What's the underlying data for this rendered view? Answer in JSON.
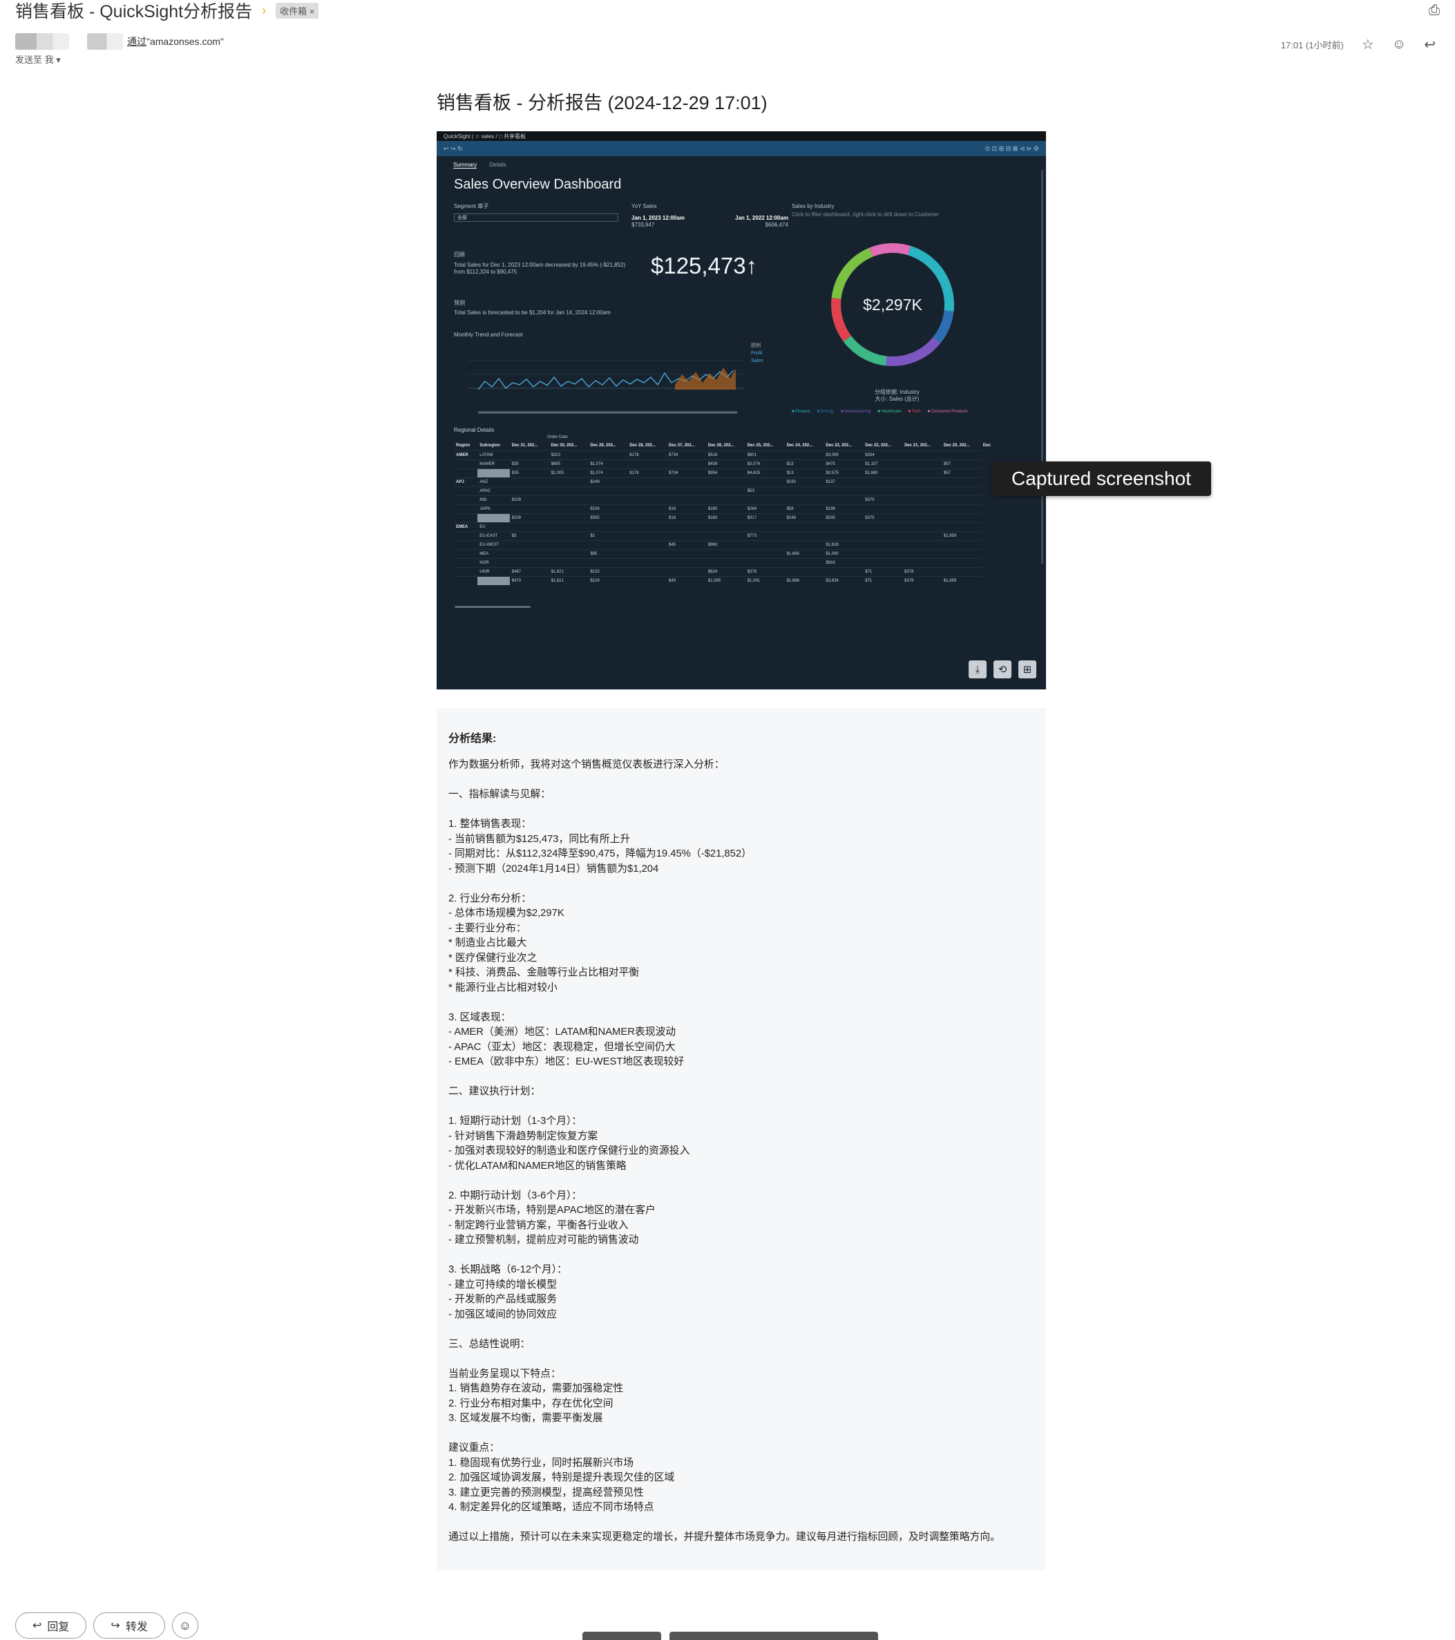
{
  "mail": {
    "subject": "销售看板 - QuickSight分析报告",
    "label": "收件箱 ×",
    "via_text": "通过",
    "via_domain": "\"amazonses.com\"",
    "to_me": "发送至 我 ▾",
    "time": "17:01 (1小时前)",
    "icons": [
      "important-icon",
      "print-icon",
      "star-icon",
      "emoji-icon",
      "reply-icon"
    ]
  },
  "report": {
    "title": "销售看板 - 分析报告 (2024-12-29 17:01)"
  },
  "dashboard": {
    "top_bar": "QuickSight | ☆ sales / □ 共享看板",
    "tabs": [
      "Summary",
      "Details"
    ],
    "title": "Sales Overview Dashboard",
    "segment_label": "Segment 章子",
    "segment_value": "全部",
    "yoy_label": "YoY Sales",
    "yoy_left_date": "Jan 1, 2023 12:00am",
    "yoy_left_value": "$733,947",
    "yoy_right_date": "Jan 1, 2022 12:00am",
    "yoy_right_value": "$606,474",
    "kpi_section": "回顾",
    "kpi_text": "Total Sales for Dec 1, 2023 12:00am decreased by 19.45% (-$21,852) from $112,324 to $90,475",
    "kpi_value": "$125,473↑",
    "forecast_section": "预测",
    "forecast_text": "Total Sales is forecasted to be $1,204 for Jan 14, 2024 12:00am",
    "industry_title": "Sales by Industry",
    "industry_hint": "Click to filter dashboard, right-click to drill down to Customer",
    "donut_total": "$2,297K",
    "donut_caption_1": "分组依据: Industry",
    "donut_caption_2": "大小: Sales (总计)",
    "donut_colors": [
      "#2ab3c0",
      "#2d6fb3",
      "#7d57c1",
      "#3fb889",
      "#e0434f",
      "#7bc142",
      "#df6db5"
    ],
    "donut_shares": [
      0.22,
      0.09,
      0.16,
      0.13,
      0.12,
      0.17,
      0.11
    ],
    "legend": [
      "Finance",
      "Energy",
      "Manufacturing",
      "Healthcare",
      "Tech",
      "Consumer Products"
    ],
    "trend_title": "Monthly Trend and Forecast",
    "trend_legend": [
      "图例",
      "Profit",
      "Sales"
    ],
    "regional_title": "Regional Details",
    "order_date": "Order Date",
    "table_headers": [
      "Region",
      "Subregion",
      "Dec 31, 202...",
      "Dec 30, 202...",
      "Dec 29, 202...",
      "Dec 28, 202...",
      "Dec 27, 202...",
      "Dec 26, 202...",
      "Dec 25, 202...",
      "Dec 24, 202...",
      "Dec 23, 202...",
      "Dec 22, 202...",
      "Dec 21, 202...",
      "Dec 20, 202...",
      "Dec"
    ],
    "table_rows": [
      [
        "AMER",
        "LATAM",
        "",
        "$310",
        "",
        "$178",
        "$734",
        "$516",
        "$601",
        "",
        "$3,099",
        "$334",
        "",
        ""
      ],
      [
        "",
        "NAMER",
        "$35",
        "$695",
        "$1,074",
        "",
        "",
        "$438",
        "$3,074",
        "$13",
        "$475",
        "$1,157",
        "",
        "$57"
      ],
      [
        "",
        "总计",
        "$35",
        "$1,005",
        "$1,074",
        "$178",
        "$734",
        "$954",
        "$4,625",
        "$13",
        "$3,575",
        "$1,680",
        "",
        "$57"
      ],
      [
        "APJ",
        "ANZ",
        "",
        "",
        "$249",
        "",
        "",
        "",
        "",
        "$190",
        "$137",
        "",
        "",
        ""
      ],
      [
        "",
        "APAC",
        "",
        "",
        "",
        "",
        "",
        "",
        "$53",
        "",
        "",
        "",
        "",
        ""
      ],
      [
        "",
        "IND",
        "$209",
        "",
        "",
        "",
        "",
        "",
        "",
        "",
        "",
        "$375",
        "",
        ""
      ],
      [
        "",
        "JAPN",
        "",
        "",
        "$106",
        "",
        "$16",
        "$160",
        "$264",
        "$58",
        "$198",
        "",
        "",
        ""
      ],
      [
        "",
        "总计",
        "$209",
        "",
        "$355",
        "",
        "$16",
        "$160",
        "$317",
        "$248",
        "$335",
        "$375",
        "",
        ""
      ],
      [
        "EMEA",
        "EU",
        "",
        "",
        "",
        "",
        "",
        "",
        "",
        "",
        "",
        "",
        "",
        ""
      ],
      [
        "",
        "EU-EAST",
        "$3",
        "",
        "$1",
        "",
        "",
        "",
        "$773",
        "",
        "",
        "",
        "",
        "$1,859"
      ],
      [
        "",
        "EU-WEST",
        "",
        "",
        "",
        "",
        "$45",
        "$960",
        "",
        "",
        "$1,628",
        "",
        "",
        ""
      ],
      [
        "",
        "MEA",
        "",
        "",
        "$95",
        "",
        "",
        "",
        "",
        "$1,666",
        "$1,090",
        "",
        "",
        ""
      ],
      [
        "",
        "NOR",
        "",
        "",
        "",
        "",
        "",
        "",
        "",
        "",
        "$916",
        "",
        "",
        ""
      ],
      [
        "",
        "UKIR",
        "$467",
        "$1,821",
        "$133",
        "",
        "",
        "$624",
        "$378",
        "",
        "",
        "$71",
        "$378",
        ""
      ],
      [
        "",
        "总计",
        "$470",
        "$1,821",
        "$229",
        "",
        "$45",
        "$1,595",
        "$1,091",
        "$1,666",
        "$3,634",
        "$71",
        "$378",
        "$1,859"
      ]
    ],
    "bottom_icons": [
      "download-icon",
      "share-icon",
      "add-icon"
    ]
  },
  "tooltip": "Captured screenshot",
  "analysis": {
    "lines": [
      {
        "t": "分析结果:",
        "bold": true
      },
      {
        "t": "作为数据分析师，我将对这个销售概览仪表板进行深入分析："
      },
      {
        "t": ""
      },
      {
        "t": "一、指标解读与见解："
      },
      {
        "t": ""
      },
      {
        "t": "1. 整体销售表现："
      },
      {
        "t": "- 当前销售额为$125,473，同比有所上升"
      },
      {
        "t": "- 同期对比：从$112,324降至$90,475，降幅为19.45%（-$21,852）"
      },
      {
        "t": "- 预测下期（2024年1月14日）销售额为$1,204"
      },
      {
        "t": ""
      },
      {
        "t": "2. 行业分布分析："
      },
      {
        "t": "- 总体市场规模为$2,297K"
      },
      {
        "t": "- 主要行业分布："
      },
      {
        "t": "* 制造业占比最大"
      },
      {
        "t": "* 医疗保健行业次之"
      },
      {
        "t": "* 科技、消费品、金融等行业占比相对平衡"
      },
      {
        "t": "* 能源行业占比相对较小"
      },
      {
        "t": ""
      },
      {
        "t": "3. 区域表现："
      },
      {
        "t": "- AMER（美洲）地区：LATAM和NAMER表现波动"
      },
      {
        "t": "- APAC（亚太）地区：表现稳定，但增长空间仍大"
      },
      {
        "t": "- EMEA（欧非中东）地区：EU-WEST地区表现较好"
      },
      {
        "t": ""
      },
      {
        "t": "二、建议执行计划："
      },
      {
        "t": ""
      },
      {
        "t": "1. 短期行动计划（1-3个月）："
      },
      {
        "t": "- 针对销售下滑趋势制定恢复方案"
      },
      {
        "t": "- 加强对表现较好的制造业和医疗保健行业的资源投入"
      },
      {
        "t": "- 优化LATAM和NAMER地区的销售策略"
      },
      {
        "t": ""
      },
      {
        "t": "2. 中期行动计划（3-6个月）："
      },
      {
        "t": "- 开发新兴市场，特别是APAC地区的潜在客户"
      },
      {
        "t": "- 制定跨行业营销方案，平衡各行业收入"
      },
      {
        "t": "- 建立预警机制，提前应对可能的销售波动"
      },
      {
        "t": ""
      },
      {
        "t": "3. 长期战略（6-12个月）："
      },
      {
        "t": "- 建立可持续的增长模型"
      },
      {
        "t": "- 开发新的产品线或服务"
      },
      {
        "t": "- 加强区域间的协同效应"
      },
      {
        "t": ""
      },
      {
        "t": "三、总结性说明："
      },
      {
        "t": ""
      },
      {
        "t": "当前业务呈现以下特点："
      },
      {
        "t": "1. 销售趋势存在波动，需要加强稳定性"
      },
      {
        "t": "2. 行业分布相对集中，存在优化空间"
      },
      {
        "t": "3. 区域发展不均衡，需要平衡发展"
      },
      {
        "t": ""
      },
      {
        "t": "建议重点："
      },
      {
        "t": "1. 稳固现有优势行业，同时拓展新兴市场"
      },
      {
        "t": "2. 加强区域协调发展，特别是提升表现欠佳的区域"
      },
      {
        "t": "3. 建立更完善的预测模型，提高经营预见性"
      },
      {
        "t": "4. 制定差异化的区域策略，适应不同市场特点"
      },
      {
        "t": ""
      },
      {
        "t": "通过以上措施，预计可以在未来实现更稳定的增长，并提升整体市场竞争力。建议每月进行指标回顾，及时调整策略方向。"
      }
    ]
  },
  "footer": {
    "reply": "回复",
    "forward": "转发"
  }
}
